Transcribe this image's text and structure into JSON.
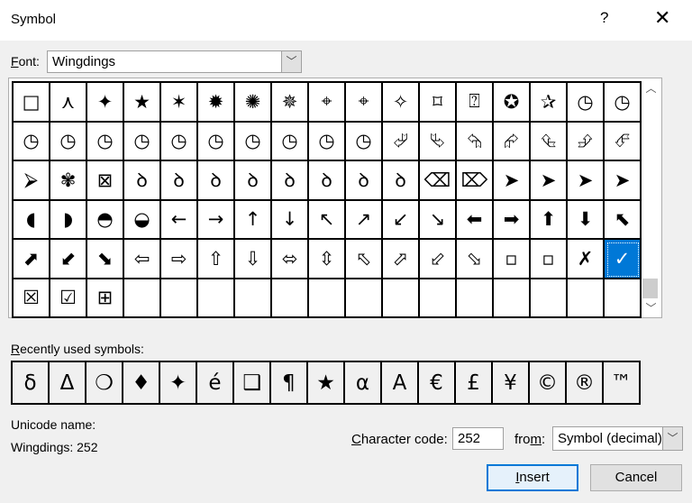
{
  "window": {
    "title": "Symbol",
    "help": "?",
    "close": "✕"
  },
  "font": {
    "label_pre": "",
    "label_u": "F",
    "label_post": "ont:",
    "value": "Wingdings"
  },
  "symbols": [
    [
      "□",
      "⋏",
      "✦",
      "★",
      "✶",
      "✹",
      "✺",
      "✵",
      "⌖",
      "⌖",
      "✧",
      "⌑",
      "⍰",
      "✪",
      "✰",
      "◷",
      "◷"
    ],
    [
      "◷",
      "◷",
      "◷",
      "◷",
      "◷",
      "◷",
      "◷",
      "◷",
      "◷",
      "◷",
      "⮰",
      "⮱",
      "⮲",
      "⮳",
      "⮴",
      "⮵",
      "⮶"
    ],
    [
      "⮚",
      "✾",
      "⊠",
      "ꝺ",
      "ꝺ",
      "ꝺ",
      "ꝺ",
      "ꝺ",
      "ꝺ",
      "ꝺ",
      "ꝺ",
      "⌫",
      "⌦",
      "➤",
      "➤",
      "➤",
      "➤"
    ],
    [
      "◖",
      "◗",
      "◓",
      "◒",
      "←",
      "→",
      "↑",
      "↓",
      "↖",
      "↗",
      "↙",
      "↘",
      "⬅",
      "➡",
      "⬆",
      "⬇",
      "⬉"
    ],
    [
      "⬈",
      "⬋",
      "⬊",
      "⇦",
      "⇨",
      "⇧",
      "⇩",
      "⬄",
      "⇳",
      "⬁",
      "⬀",
      "⬃",
      "⬂",
      "▫",
      "▫",
      "✗",
      "✓"
    ],
    [
      "☒",
      "☑",
      "⊞",
      "",
      "",
      "",
      "",
      "",
      "",
      "",
      "",
      "",
      "",
      "",
      "",
      "",
      ""
    ]
  ],
  "selected": {
    "row": 4,
    "col": 16
  },
  "recent": {
    "label_u": "R",
    "label_post": "ecently used symbols:",
    "items": [
      "δ",
      "Δ",
      "❍",
      "♦",
      "✦",
      "é",
      "❑",
      "¶",
      "★",
      "α",
      "A",
      "€",
      "£",
      "¥",
      "©",
      "®",
      "™"
    ]
  },
  "unicode_name": {
    "label": "Unicode name:",
    "value": "Wingdings: 252"
  },
  "char_code": {
    "label_u": "C",
    "label_post": "haracter code:",
    "value": "252"
  },
  "from": {
    "label_pre": "fro",
    "label_u": "m",
    "label_post": ":",
    "value": "Symbol (decimal)"
  },
  "buttons": {
    "insert_u": "I",
    "insert_post": "nsert",
    "cancel": "Cancel"
  },
  "colors": {
    "accent": "#0078d7"
  }
}
